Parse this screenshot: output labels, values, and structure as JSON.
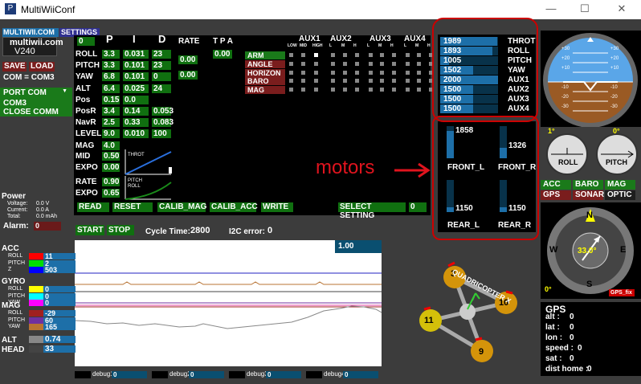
{
  "window": {
    "title": "MultiWiiConf",
    "min_icon": "—",
    "max_icon": "☐",
    "close_icon": "✕"
  },
  "header": {
    "tab_multiwii": "MULTIWII.COM",
    "tab_settings": "SETTINGS",
    "site": "multiwii.com",
    "version": "V240"
  },
  "buttons": {
    "save": "SAVE",
    "load": "LOAD",
    "com": "COM = COM3",
    "port_com": "PORT COM",
    "com3": "COM3",
    "close_comm": "CLOSE COMM",
    "read": "READ",
    "reset": "RESET",
    "calib_mag": "CALIB_MAG",
    "calib_acc": "CALIB_ACC",
    "write": "WRITE",
    "select_setting": "SELECT SETTING",
    "setting_value": "0",
    "start": "START",
    "stop": "STOP"
  },
  "power": {
    "title": "Power",
    "voltage_label": "Voltage:",
    "voltage": "0.0 V",
    "current_label": "Current:",
    "current": "0.0 A",
    "total_label": "Total:",
    "total": "0.0 mAh",
    "alarm_label": "Alarm:",
    "alarm_value": "0"
  },
  "pid": {
    "headers": [
      "P",
      "I",
      "D",
      "RATE",
      "T P A"
    ],
    "top_value": "0",
    "rows": [
      {
        "name": "ROLL",
        "p": "3.3",
        "i": "0.031",
        "d": "23"
      },
      {
        "name": "PITCH",
        "p": "3.3",
        "i": "0.101",
        "d": "23"
      },
      {
        "name": "YAW",
        "p": "6.8",
        "i": "0.101",
        "d": "0"
      },
      {
        "name": "ALT",
        "p": "6.4",
        "i": "0.025",
        "d": "24"
      },
      {
        "name": "Pos",
        "p": "0.15",
        "i": "0.0",
        "d": ""
      },
      {
        "name": "PosR",
        "p": "3.4",
        "i": "0.14",
        "d": "0.053"
      },
      {
        "name": "NavR",
        "p": "2.5",
        "i": "0.33",
        "d": "0.083"
      },
      {
        "name": "LEVEL",
        "p": "9.0",
        "i": "0.010",
        "d": "100"
      },
      {
        "name": "MAG",
        "p": "4.0",
        "i": "",
        "d": ""
      }
    ],
    "rate_rp": "0.00",
    "rate_yaw": "0.00",
    "tpa": "0.00",
    "mid_label": "MID",
    "mid": "0.50",
    "expo_label": "EXPO",
    "expo": "0.00",
    "throt_label": "THROT",
    "rate_label": "RATE",
    "rate": "0.90",
    "expo2_label": "EXPO",
    "expo2": "0.65",
    "pitch_label": "PITCH",
    "roll_label": "ROLL"
  },
  "aux": {
    "headers": [
      "AUX1",
      "AUX2",
      "AUX3",
      "AUX4"
    ],
    "sub": [
      "LOW",
      "MID",
      "HIGH",
      "L",
      "M",
      "H",
      "L",
      "M",
      "H",
      "L",
      "M",
      "H"
    ],
    "modes": [
      {
        "name": "ARM",
        "color": "#1a7a1a"
      },
      {
        "name": "ANGLE",
        "color": "#7a1d1d"
      },
      {
        "name": "HORIZON",
        "color": "#7a1d1d"
      },
      {
        "name": "BARO",
        "color": "#7a1d1d"
      },
      {
        "name": "MAG",
        "color": "#7a1d1d"
      }
    ]
  },
  "rc": [
    {
      "value": "1989",
      "name": "THROT",
      "frac": 0.99
    },
    {
      "value": "1893",
      "name": "ROLL",
      "frac": 0.89
    },
    {
      "value": "1005",
      "name": "PITCH",
      "frac": 0.0
    },
    {
      "value": "1502",
      "name": "YAW",
      "frac": 0.5
    },
    {
      "value": "2000",
      "name": "AUX1",
      "frac": 1.0
    },
    {
      "value": "1500",
      "name": "AUX2",
      "frac": 0.5
    },
    {
      "value": "1500",
      "name": "AUX3",
      "frac": 0.5
    },
    {
      "value": "1500",
      "name": "AUX4",
      "frac": 0.5
    }
  ],
  "motors": {
    "front_l": "1858",
    "front_r": "1326",
    "rear_l": "1150",
    "rear_r": "1150",
    "front_l_label": "FRONT_L",
    "front_r_label": "FRONT_R",
    "rear_l_label": "REAR_L",
    "rear_r_label": "REAR_R",
    "annotation": "motors"
  },
  "cycle": {
    "label": "Cycle Time:",
    "value": "2800",
    "i2c_label": "I2C error:",
    "i2c_value": "0"
  },
  "graph": {
    "scale": "1.00"
  },
  "sensors": {
    "acc": {
      "title": "ACC",
      "items": [
        {
          "name": "ROLL",
          "value": "11",
          "color": "#ff0000"
        },
        {
          "name": "PITCH",
          "value": "2",
          "color": "#00dd00"
        },
        {
          "name": "Z",
          "value": "503",
          "color": "#0000ff"
        }
      ]
    },
    "gyro": {
      "title": "GYRO",
      "items": [
        {
          "name": "ROLL",
          "value": "0",
          "color": "#ffff00"
        },
        {
          "name": "PITCH",
          "value": "0",
          "color": "#00ffff"
        },
        {
          "name": "YAW",
          "value": "0",
          "color": "#ff00ff"
        }
      ]
    },
    "mag": {
      "title": "MAG",
      "items": [
        {
          "name": "ROLL",
          "value": "-29",
          "color": "#a02020"
        },
        {
          "name": "PITCH",
          "value": "60",
          "color": "#7030a0"
        },
        {
          "name": "YAW",
          "value": "165",
          "color": "#b87333"
        }
      ]
    },
    "alt": {
      "title": "ALT",
      "value": "0.74",
      "color": "#888888"
    },
    "head": {
      "title": "HEAD",
      "value": "33",
      "color": "#444444"
    }
  },
  "debug": [
    {
      "label": "debug1",
      "value": "0"
    },
    {
      "label": "debug2",
      "value": "0"
    },
    {
      "label": "debug3",
      "value": "0"
    },
    {
      "label": "debug4",
      "value": "0"
    }
  ],
  "quad": {
    "label": "QUADRICOPTER X",
    "m1": "3",
    "m2": "10",
    "m3": "11",
    "m4": "9"
  },
  "horizon": {
    "ticks": [
      "+30",
      "+20",
      "+10",
      "-10",
      "-20",
      "-30"
    ],
    "roll_angle": "1°",
    "pitch_angle": "0°",
    "roll_label": "ROLL",
    "pitch_label": "PITCH"
  },
  "sensor_status": {
    "acc": "ACC",
    "baro": "BARO",
    "mag": "MAG",
    "gps": "GPS",
    "sonar": "SONAR",
    "optic": "OPTIC"
  },
  "compass": {
    "heading": "33.0°",
    "n": "N",
    "s": "S",
    "e": "E",
    "w": "W",
    "angle": "0°",
    "gps_fix": "GPS_fix"
  },
  "gps": {
    "title": "GPS",
    "alt_label": "alt :",
    "alt": "0",
    "lat_label": "lat :",
    "lat": "0",
    "lon_label": "lon :",
    "lon": "0",
    "speed_label": "speed :",
    "speed": "0",
    "sat_label": "sat :",
    "sat": "0",
    "dist_label": "dist home :",
    "dist": "0"
  }
}
